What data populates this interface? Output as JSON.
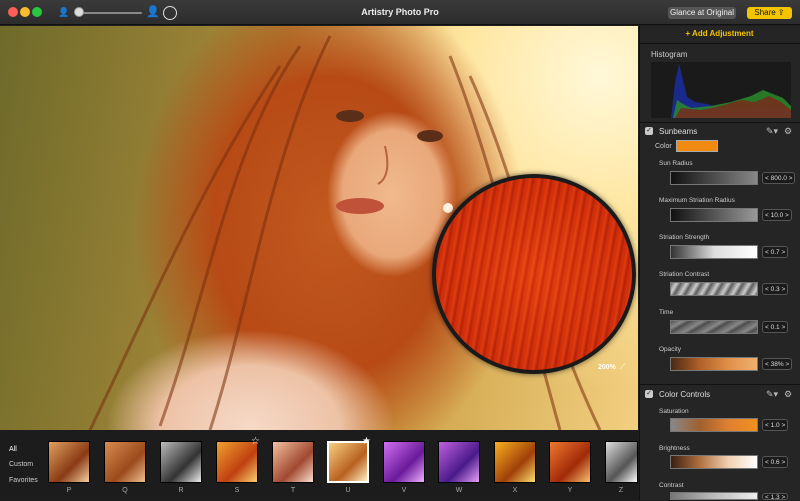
{
  "window": {
    "title": "Artistry Photo Pro"
  },
  "toolbar": {
    "glance_label": "Glance at Original",
    "share_label": "Share ⇪"
  },
  "canvas": {
    "zoom_label": "200%"
  },
  "filmstrip": {
    "categories": [
      "All",
      "Custom",
      "Favorites"
    ],
    "presets": [
      {
        "label": "P",
        "favorite": false
      },
      {
        "label": "Q",
        "favorite": false
      },
      {
        "label": "R",
        "favorite": false
      },
      {
        "label": "S",
        "favorite": true
      },
      {
        "label": "T",
        "favorite": false
      },
      {
        "label": "U",
        "favorite": true,
        "selected": true
      },
      {
        "label": "V",
        "favorite": false
      },
      {
        "label": "W",
        "favorite": false
      },
      {
        "label": "X",
        "favorite": false
      },
      {
        "label": "Y",
        "favorite": false
      },
      {
        "label": "Z",
        "favorite": false
      }
    ]
  },
  "panel": {
    "add_adjustment": "+ Add Adjustment",
    "histogram_label": "Histogram",
    "sunbeams": {
      "title": "Sunbeams",
      "color_label": "Color",
      "color_value": "#f08a10",
      "sliders": [
        {
          "label": "Sun Radius",
          "value": "< 800.0 >"
        },
        {
          "label": "Maximum Striation Radius",
          "value": "< 10.0 >"
        },
        {
          "label": "Striation Strength",
          "value": "< 0.7 >"
        },
        {
          "label": "Striation Contrast",
          "value": "< 0.3 >"
        },
        {
          "label": "Time",
          "value": "< 0.1 >"
        },
        {
          "label": "Opacity",
          "value": "< 38% >"
        }
      ]
    },
    "color_controls": {
      "title": "Color Controls",
      "sliders": [
        {
          "label": "Saturation",
          "value": "< 1.0 >"
        },
        {
          "label": "Brightness",
          "value": "< 0.6 >"
        },
        {
          "label": "Contrast",
          "value": "< 1.3 >"
        }
      ]
    }
  },
  "colors": {
    "accent": "#f5c400",
    "panel_bg": "#252525"
  }
}
